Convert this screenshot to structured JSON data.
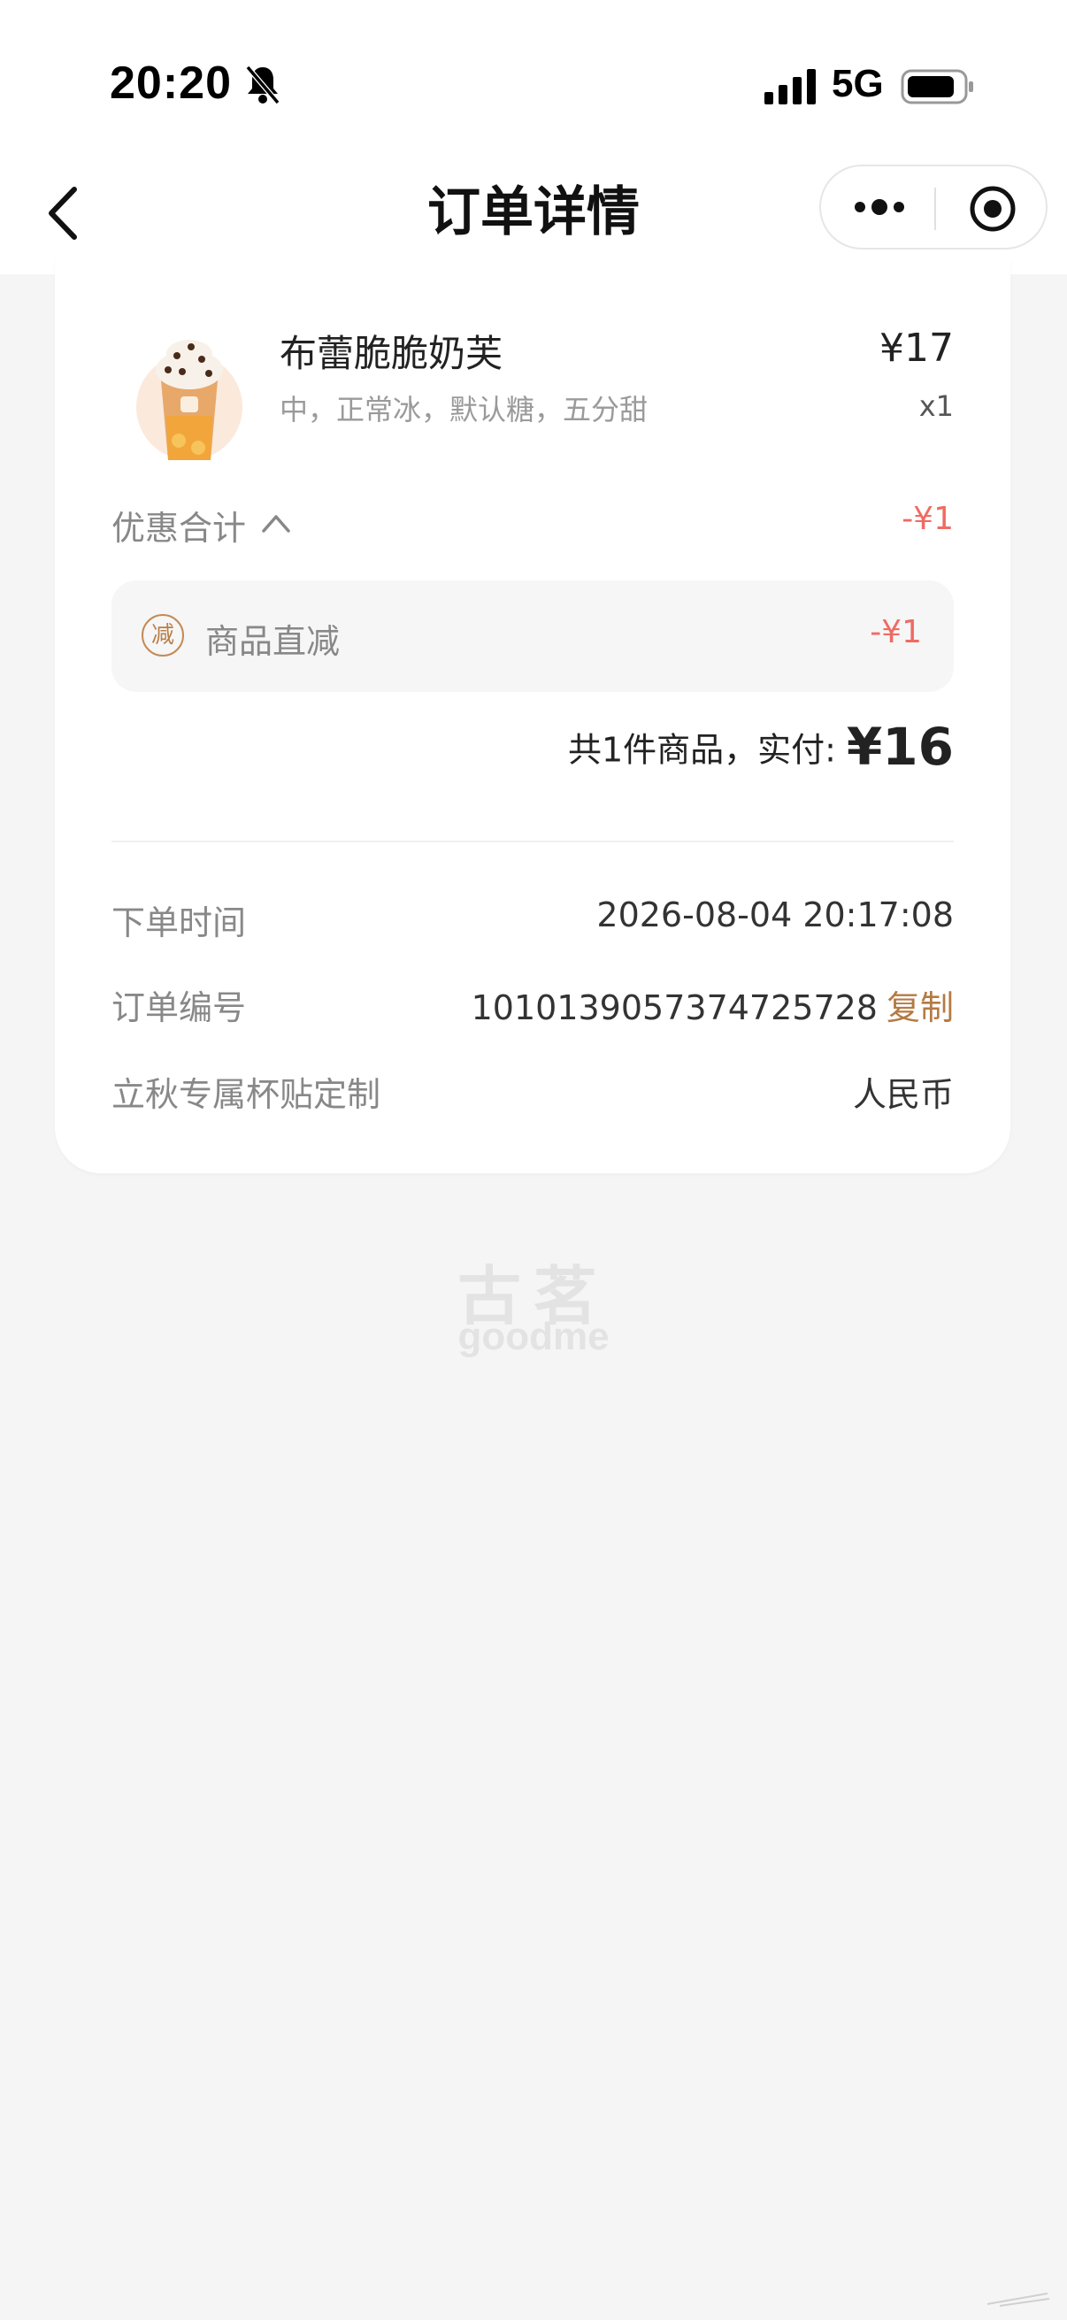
{
  "status_bar": {
    "time": "20:20",
    "network": "5G"
  },
  "nav": {
    "title": "订单详情"
  },
  "product": {
    "name": "布蕾脆脆奶芙",
    "spec": "中，正常冰，默认糖，五分甜",
    "price": "¥17",
    "qty": "x1"
  },
  "discount": {
    "label": "优惠合计",
    "total": "-¥1",
    "item_badge": "减",
    "item_label": "商品直减",
    "item_value": "-¥1"
  },
  "summary": {
    "label": "共1件商品，实付:",
    "amount": "¥16"
  },
  "info": {
    "order_time_label": "下单时间",
    "order_time_value": "2026-08-04 20:17:08",
    "order_no_label": "订单编号",
    "order_no_value": "1010139057374725728",
    "copy_label": "复制",
    "custom_label": "立秋专属杯贴定制",
    "custom_value": "人民币"
  },
  "brand": {
    "cn": "古茗",
    "en": "goodme"
  },
  "colors": {
    "accent": "#b47a44",
    "discount_red": "#ef6b62",
    "background": "#f5f5f5"
  }
}
